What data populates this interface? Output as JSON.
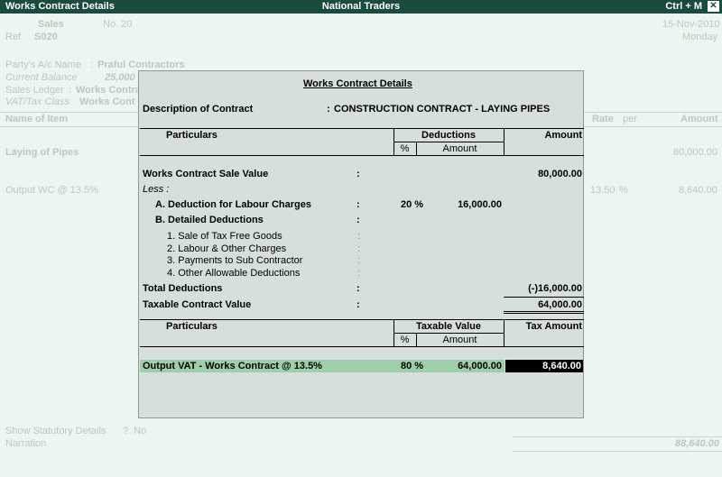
{
  "titlebar": {
    "left": "Works Contract Details",
    "center": "National Traders",
    "right": "Ctrl + M",
    "close": "✕"
  },
  "background": {
    "voucher_type": "Sales",
    "voucher_no": "No. 20",
    "date": "15-Nov-2010",
    "day": "Monday",
    "ref_label": "Ref",
    "ref_value": "S020",
    "party_label": "Party's A/c Name",
    "party_value": "Praful Contractors",
    "balance_label": "Current Balance",
    "balance_value": "25,000",
    "ledger_label": "Sales Ledger",
    "ledger_value": "Works Contra",
    "vat_label": "VAT/Tax Class",
    "vat_value": "Works Cont",
    "col_name": "Name of Item",
    "col_rate": "Rate",
    "col_per": "per",
    "col_amount": "Amount",
    "item_name": "Laying of Pipes",
    "item_amount": "80,000.00",
    "tax_name": "Output WC @ 13.5%",
    "tax_rate": "13.50",
    "tax_pct": "%",
    "tax_amount": "8,640.00",
    "statutory_label": "Show Statutory Details",
    "statutory_q": "?",
    "statutory_value": "No",
    "narration_label": "Narration",
    "total_amount": "88,640.00"
  },
  "modal": {
    "title": "Works Contract Details",
    "desc_label": "Description of Contract",
    "desc_colon": ":",
    "desc_value": "CONSTRUCTION CONTRACT - LAYING PIPES",
    "table1": {
      "col_particulars": "Particulars",
      "col_deductions": "Deductions",
      "col_pct": "%",
      "col_amount_sub": "Amount",
      "col_amount": "Amount"
    },
    "rows": {
      "sale_value_label": "Works Contract Sale Value",
      "sale_value_amount": "80,000.00",
      "less_label": "Less :",
      "labour_label": "A. Deduction for Labour Charges",
      "labour_pct": "20 %",
      "labour_amount": "16,000.00",
      "detailed_label": "B. Detailed Deductions",
      "sub1": "1. Sale of Tax Free Goods",
      "sub2": "2. Labour & Other Charges",
      "sub3": "3. Payments to Sub Contractor",
      "sub4": "4. Other Allowable Deductions",
      "total_ded_label": "Total Deductions",
      "total_ded_amount": "(-)16,000.00",
      "taxable_label": "Taxable Contract Value",
      "taxable_amount": "64,000.00",
      "colon": ":"
    },
    "table2": {
      "col_particulars": "Particulars",
      "col_taxable": "Taxable Value",
      "col_pct": "%",
      "col_amount_sub": "Amount",
      "col_tax_amount": "Tax Amount"
    },
    "vat_row": {
      "label": "Output VAT - Works Contract @ 13.5%",
      "pct": "80 %",
      "amount": "64,000.00",
      "tax": "8,640.00"
    }
  }
}
